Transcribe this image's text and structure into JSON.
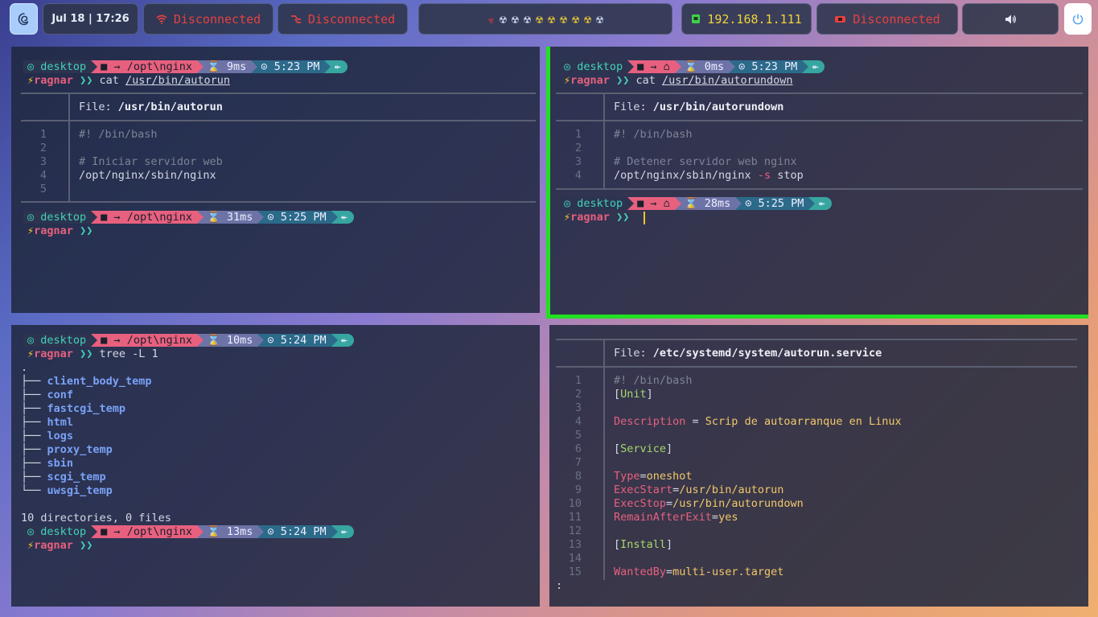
{
  "topbar": {
    "logo_icon": "debian-swirl-icon",
    "datetime": "Jul 18 | 17:26",
    "status1": "Disconnected",
    "status2": "Disconnected",
    "hazards": [
      "☣",
      "☢",
      "☢",
      "☢",
      "☢",
      "☢",
      "☢",
      "☢",
      "☢",
      "☢"
    ],
    "ip": "192.168.1.111",
    "status3": "Disconnected",
    "volume_icon": "🔊",
    "power_icon": "⏻"
  },
  "panes": {
    "tl": {
      "prompt1": {
        "host": "desktop",
        "path": "/opt\\nginx",
        "dur": "9ms",
        "clock": "5:23 PM"
      },
      "user": "ragnar",
      "cmd1": "cat",
      "arg1": "/usr/bin/autorun",
      "file_label": "File: ",
      "file_name": "/usr/bin/autorun",
      "lines": [
        "#! /bin/bash",
        "",
        "# Iniciar servidor web",
        "/opt/nginx/sbin/nginx",
        ""
      ],
      "linenos": [
        "1",
        "2",
        "3",
        "4",
        "5"
      ],
      "prompt2": {
        "host": "desktop",
        "path": "/opt\\nginx",
        "dur": "31ms",
        "clock": "5:25 PM"
      }
    },
    "tr": {
      "prompt1": {
        "host": "desktop",
        "dur": "0ms",
        "clock": "5:23 PM"
      },
      "user": "ragnar",
      "cmd1": "cat",
      "arg1": "/usr/bin/autorundown",
      "file_label": "File: ",
      "file_name": "/usr/bin/autorundown",
      "line1": "#! /bin/bash",
      "line3": "# Detener servidor web nginx",
      "line4a": "/opt/nginx/sbin/nginx ",
      "line4b": "-s",
      "line4c": " stop",
      "linenos": [
        "1",
        "2",
        "3",
        "4"
      ],
      "prompt2": {
        "host": "desktop",
        "dur": "28ms",
        "clock": "5:25 PM"
      }
    },
    "bl": {
      "prompt1": {
        "host": "desktop",
        "path": "/opt\\nginx",
        "dur": "10ms",
        "clock": "5:24 PM"
      },
      "user": "ragnar",
      "cmd1": "tree -L 1",
      "root": ".",
      "dirs": [
        "client_body_temp",
        "conf",
        "fastcgi_temp",
        "html",
        "logs",
        "proxy_temp",
        "sbin",
        "scgi_temp",
        "uwsgi_temp"
      ],
      "summary": "10 directories, 0 files",
      "prompt2": {
        "host": "desktop",
        "path": "/opt\\nginx",
        "dur": "13ms",
        "clock": "5:24 PM"
      }
    },
    "br": {
      "file_label": "File: ",
      "file_name": "/etc/systemd/system/autorun.service",
      "linenos": [
        "1",
        "2",
        "3",
        "4",
        "5",
        "6",
        "7",
        "8",
        "9",
        "10",
        "11",
        "12",
        "13",
        "14",
        "15"
      ],
      "l1": "#! /bin/bash",
      "l2": "Unit",
      "l4k": "Description",
      "l4v": "Scrip de autoarranque en Linux",
      "l6": "Service",
      "l8k": "Type",
      "l8v": "oneshot",
      "l9k": "ExecStart",
      "l9v": "/usr/bin/autorun",
      "l10k": "ExecStop",
      "l10v": "/usr/bin/autorundown",
      "l11k": "RemainAfterExit",
      "l11v": "yes",
      "l13": "Install",
      "l15k": "WantedBy",
      "l15v": "multi-user.target",
      "pager": ":"
    }
  }
}
